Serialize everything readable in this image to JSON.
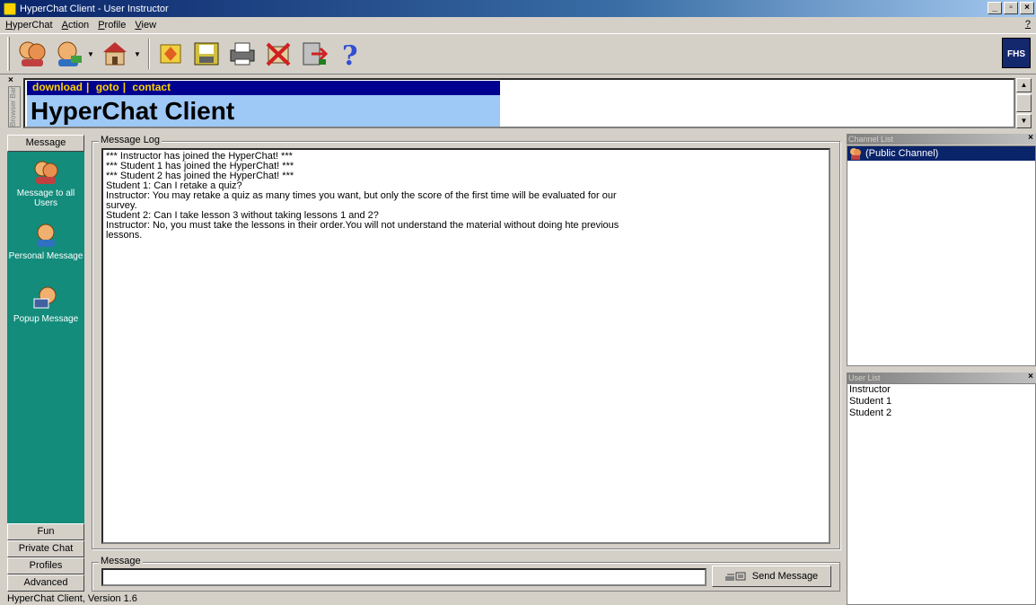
{
  "window": {
    "title": "HyperChat Client - User Instructor"
  },
  "menu": {
    "items": [
      {
        "pre": "",
        "accel": "H",
        "post": "yperChat"
      },
      {
        "pre": "",
        "accel": "A",
        "post": "ction"
      },
      {
        "pre": "",
        "accel": "P",
        "post": "rofile"
      },
      {
        "pre": "",
        "accel": "V",
        "post": "iew"
      }
    ],
    "help": "?"
  },
  "toolbar": {
    "logo_text": "FHS"
  },
  "browser_bar": {
    "close": "×",
    "side_label": "Browser Bar",
    "links": [
      "download",
      "|",
      "goto",
      "|",
      "contact"
    ],
    "banner": "HyperChat Client"
  },
  "sidebar": {
    "top_tab": "Message",
    "items": [
      {
        "label": "Message to all Users"
      },
      {
        "label": "Personal Message"
      },
      {
        "label": "Popup Message"
      }
    ],
    "bottom_tabs": [
      "Fun",
      "Private Chat",
      "Profiles",
      "Advanced"
    ]
  },
  "message_log": {
    "label": "Message Log",
    "lines": [
      "*** Instructor has joined the HyperChat! ***",
      "*** Student 1 has joined the HyperChat! ***",
      "*** Student 2 has joined the HyperChat! ***",
      "Student 1: Can I retake a quiz?",
      "Instructor: You may retake a quiz as many times you want, but only the score of the first time will be evaluated for our",
      "survey.",
      "Student 2: Can I take lesson 3 without taking lessons 1 and 2?",
      "Instructor: No, you must take the lessons in their order.You will not understand the material without doing hte previous",
      "lessons."
    ]
  },
  "message_input": {
    "label": "Message",
    "value": "",
    "send_label": "Send Message"
  },
  "channel_list": {
    "title": "Channel List",
    "close": "×",
    "items": [
      "(Public Channel)"
    ]
  },
  "user_list": {
    "title": "User List",
    "close": "×",
    "items": [
      "Instructor",
      "Student 1",
      "Student 2"
    ]
  },
  "status": {
    "text": "HyperChat Client, Version 1.6"
  }
}
